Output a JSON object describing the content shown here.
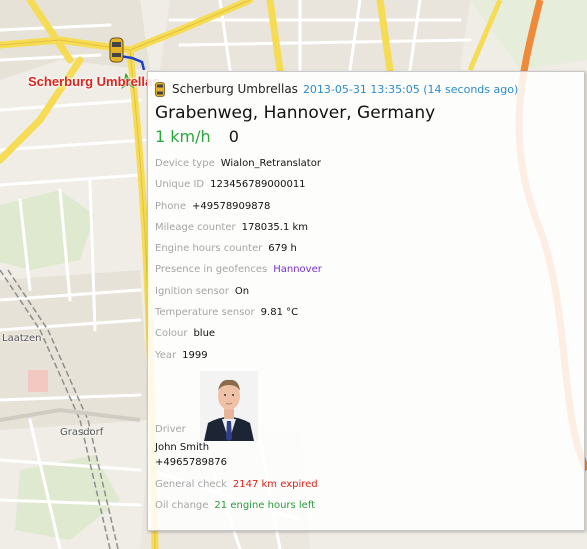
{
  "map": {
    "place_labels": [
      "Laatzen",
      "Grasdorf"
    ],
    "colors": {
      "background": "#f0ede6",
      "main_road": "#f6dc54",
      "motorway": "#ef8a3a",
      "minor_road": "#ffffff",
      "railway": "#8d8d8d"
    },
    "marker": {
      "unit_label": "Scherburg Umbrellas",
      "unit_label_color": "#e0241b",
      "direction_arrow_color": "#36c230",
      "track_color": "#1f3ec8",
      "icon": "car-icon"
    }
  },
  "tooltip": {
    "unit_name": "Scherburg Umbrellas",
    "timestamp": "2013-05-31 13:35:05 (14 seconds ago)",
    "address": "Grabenweg, Hannover, Germany",
    "speed": "1 km/h",
    "course": "0",
    "rows": [
      {
        "label": "Device type",
        "value": "Wialon_Retranslator"
      },
      {
        "label": "Unique ID",
        "value": "123456789000011"
      },
      {
        "label": "Phone",
        "value": "+49578909878"
      },
      {
        "label": "Mileage counter",
        "value": "178035.1 km"
      },
      {
        "label": "Engine hours counter",
        "value": "679 h"
      },
      {
        "label": "Presence in geofences",
        "value": "Hannover"
      },
      {
        "label": "Ignition sensor",
        "value": "On"
      },
      {
        "label": "Temperature sensor",
        "value": "9.81 °C"
      },
      {
        "label": "Colour",
        "value": "blue"
      },
      {
        "label": "Year",
        "value": "1999"
      }
    ],
    "driver": {
      "label": "Driver",
      "name": "John Smith",
      "phone": "+4965789876",
      "photo_icon": "driver-photo"
    },
    "service": [
      {
        "label": "General check",
        "value": "2147 km expired",
        "status": "expired"
      },
      {
        "label": "Oil change",
        "value": "21 engine hours left",
        "status": "ok"
      }
    ],
    "colors": {
      "time": "#2a8bc9",
      "speed": "#2aa83c",
      "label": "#a5a5a5",
      "geofence": "#7a2fd0",
      "expired": "#e0241b",
      "ok": "#2a9c3c"
    }
  }
}
